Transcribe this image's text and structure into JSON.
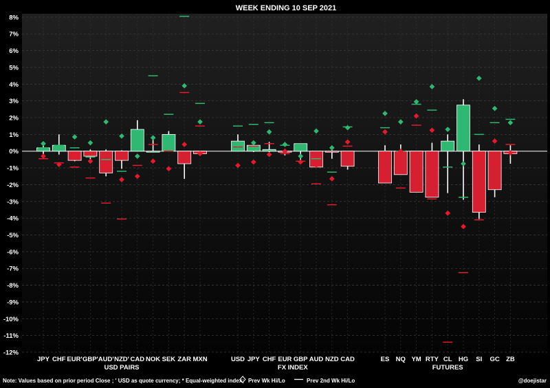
{
  "chart_data": {
    "type": "bar",
    "title": "WEEK ENDING  10 SEP 2021",
    "ylim": [
      -12,
      8.2
    ],
    "yticks": [
      {
        "v": 8,
        "label": "8%"
      },
      {
        "v": 7,
        "label": "7%"
      },
      {
        "v": 6,
        "label": "6%"
      },
      {
        "v": 5,
        "label": "5%"
      },
      {
        "v": 4,
        "label": "4%"
      },
      {
        "v": 3,
        "label": "3%"
      },
      {
        "v": 2,
        "label": "2%"
      },
      {
        "v": 1,
        "label": "1%"
      },
      {
        "v": 0,
        "label": "0%"
      },
      {
        "v": -1,
        "label": "-1%"
      },
      {
        "v": -2,
        "label": "-2%"
      },
      {
        "v": -3,
        "label": "-3%"
      },
      {
        "v": -4,
        "label": "-4%"
      },
      {
        "v": -5,
        "label": "-5%"
      },
      {
        "v": -6,
        "label": "-6%"
      },
      {
        "v": -7,
        "label": "-7%"
      },
      {
        "v": -8,
        "label": "-8%"
      },
      {
        "v": -9,
        "label": "-9%"
      },
      {
        "v": -10,
        "label": "-10%"
      },
      {
        "v": -11,
        "label": "-11%"
      },
      {
        "v": -12,
        "label": "-12%"
      }
    ],
    "grid": true,
    "colors": {
      "up": "#2eb872",
      "down": "#d42030",
      "diamond_up": "#2eb872",
      "diamond_down": "#e8192c",
      "line_up": "#2eb872",
      "line_down": "#e8192c"
    },
    "groups": [
      {
        "label": "USD PAIRS",
        "items": [
          {
            "label": "JPY",
            "open": 0,
            "close": 0.2,
            "high": 0.35,
            "low": -0.3,
            "d_hi": 0.45,
            "d_lo": -0.3,
            "l_hi": 0.2,
            "l_lo": -0.45
          },
          {
            "label": "CHF",
            "open": 0,
            "close": 0.35,
            "high": 1.0,
            "low": -0.2,
            "d_hi": 0.2,
            "d_lo": -0.8,
            "l_hi": 0.35,
            "l_lo": -0.7
          },
          {
            "label": "EUR'",
            "open": 0,
            "close": -0.55,
            "high": 0.0,
            "low": -0.6,
            "d_hi": 0.85,
            "d_lo": -0.25,
            "l_hi": 0.2,
            "l_lo": -0.95
          },
          {
            "label": "GBP'",
            "open": 0,
            "close": -0.3,
            "high": 0.1,
            "low": -0.6,
            "d_hi": 0.5,
            "d_lo": -0.6,
            "l_hi": -0.35,
            "l_lo": -1.6
          },
          {
            "label": "AUD'",
            "open": 0,
            "close": -1.3,
            "high": 0.1,
            "low": -1.5,
            "d_hi": 1.75,
            "d_lo": -0.85,
            "l_hi": -0.5,
            "l_lo": -3.1
          },
          {
            "label": "NZD'",
            "open": 0,
            "close": -0.55,
            "high": 0.05,
            "low": -1.05,
            "d_hi": 0.9,
            "d_lo": -1.7,
            "l_hi": -1.2,
            "l_lo": -4.05
          },
          {
            "label": "CAD",
            "open": 0,
            "close": 1.3,
            "high": 1.85,
            "low": 0.0,
            "d_hi": -0.3,
            "d_lo": -1.5,
            "l_hi": 1.25,
            "l_lo": -0.85
          },
          {
            "label": "NOK",
            "open": 0,
            "close": 0.0,
            "high": 0.8,
            "low": -0.05,
            "d_hi": 0.8,
            "d_lo": -0.6,
            "l_hi": 4.5,
            "l_lo": 0.4
          },
          {
            "label": "SEK",
            "open": 0,
            "close": 1.0,
            "high": 1.2,
            "low": 0.0,
            "d_hi": 0.35,
            "d_lo": -1.05,
            "l_hi": 2.2,
            "l_lo": 0.0
          },
          {
            "label": "ZAR",
            "open": 0,
            "close": -0.75,
            "high": 0.0,
            "low": -1.65,
            "d_hi": 3.9,
            "d_lo": 0.4,
            "l_hi": 8.05,
            "l_lo": 3.5
          },
          {
            "label": "MXN",
            "open": 0,
            "close": -0.15,
            "high": 0.0,
            "low": -0.25,
            "d_hi": 1.75,
            "d_lo": -0.15,
            "l_hi": 2.85,
            "l_lo": 1.5
          }
        ]
      },
      {
        "label": "FX INDEX",
        "items": [
          {
            "label": "USD",
            "open": 0,
            "close": 0.6,
            "high": 1.0,
            "low": 0.0,
            "d_hi": 0.4,
            "d_lo": -0.85,
            "l_hi": 1.5,
            "l_lo": 0.25
          },
          {
            "label": "JPY",
            "open": 0,
            "close": 0.35,
            "high": 0.6,
            "low": -0.05,
            "d_hi": 0.5,
            "d_lo": -0.65,
            "l_hi": 1.6,
            "l_lo": 0.3
          },
          {
            "label": "CHF",
            "open": 0,
            "close": 0.1,
            "high": 0.55,
            "low": -0.05,
            "d_hi": 1.15,
            "d_lo": -0.2,
            "l_hi": 1.7,
            "l_lo": 0.45
          },
          {
            "label": "EUR",
            "open": 0,
            "close": -0.05,
            "high": 0.0,
            "low": -0.25,
            "d_hi": 0.4,
            "d_lo": 0.0,
            "l_hi": 0.35,
            "l_lo": -0.15
          },
          {
            "label": "GBP",
            "open": 0,
            "close": 0.45,
            "high": 0.45,
            "low": -0.55,
            "d_hi": -0.3,
            "d_lo": -0.65,
            "l_hi": 0.4,
            "l_lo": -0.6
          },
          {
            "label": "AUD",
            "open": 0,
            "close": -0.95,
            "high": 0.0,
            "low": -0.95,
            "d_hi": 1.2,
            "d_lo": -0.85,
            "l_hi": -0.45,
            "l_lo": -1.95
          },
          {
            "label": "NZD",
            "open": 0,
            "close": -0.05,
            "high": 0.05,
            "low": -0.45,
            "d_hi": 0.2,
            "d_lo": -1.65,
            "l_hi": -1.25,
            "l_lo": -3.2
          },
          {
            "label": "CAD",
            "open": 0,
            "close": -0.9,
            "high": 0.0,
            "low": -1.1,
            "d_hi": 1.4,
            "d_lo": 0.55,
            "l_hi": 1.45,
            "l_lo": 0.3
          }
        ]
      },
      {
        "label": "FUTURES",
        "items": [
          {
            "label": "ES",
            "open": 0,
            "close": -1.9,
            "high": 0.35,
            "low": -1.9,
            "d_hi": 2.25,
            "d_lo": 1.15,
            "l_hi": 1.4,
            "l_lo": -0.35
          },
          {
            "label": "NQ",
            "open": 0,
            "close": -1.4,
            "high": 0.4,
            "low": -1.4,
            "d_hi": 1.75,
            "d_lo": 0.0,
            "l_hi": 0.0,
            "l_lo": -2.2
          },
          {
            "label": "YM",
            "open": 0,
            "close": -2.45,
            "high": 0.0,
            "low": -2.45,
            "d_hi": 2.95,
            "d_lo": 2.1,
            "l_hi": 2.8,
            "l_lo": 1.55
          },
          {
            "label": "RTY",
            "open": 0,
            "close": -2.75,
            "high": 0.5,
            "low": -2.75,
            "d_hi": 3.85,
            "d_lo": 1.25,
            "l_hi": 2.45,
            "l_lo": -2.85
          },
          {
            "label": "CL",
            "open": 0,
            "close": 0.6,
            "high": 1.0,
            "low": -2.5,
            "d_hi": 1.3,
            "d_lo": -3.7,
            "l_hi": -0.95,
            "l_lo": -11.4
          },
          {
            "label": "HG",
            "open": 0,
            "close": 2.75,
            "high": 3.1,
            "low": -2.9,
            "d_hi": -0.75,
            "d_lo": -4.5,
            "l_hi": -2.75,
            "l_lo": -7.25
          },
          {
            "label": "SI",
            "open": 0,
            "close": -3.65,
            "high": 0.4,
            "low": -4.05,
            "d_hi": 4.35,
            "d_lo": -0.5,
            "l_hi": 1.0,
            "l_lo": -4.1
          },
          {
            "label": "GC",
            "open": 0,
            "close": -2.3,
            "high": 0.0,
            "low": -2.75,
            "d_hi": 2.55,
            "d_lo": 0.6,
            "l_hi": 1.7,
            "l_lo": -0.75
          },
          {
            "label": "ZB",
            "open": 0,
            "close": -0.15,
            "high": 0.35,
            "low": -0.75,
            "d_hi": 1.7,
            "d_lo": -0.1,
            "l_hi": 1.9,
            "l_lo": 0.4
          }
        ]
      }
    ],
    "note": {
      "prefix": "Note:  Values based on prior period Close ;  ' USD as quote currency;  * Equal-weighted index;",
      "diamond_label": "Prev Wk Hi/Lo",
      "line_label": "Prev 2nd Wk Hi/Lo"
    },
    "credit": "@doejistar"
  }
}
